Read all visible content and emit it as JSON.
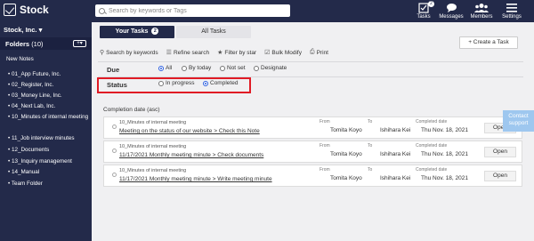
{
  "app": {
    "name": "Stock"
  },
  "search": {
    "placeholder": "Search by keywords or Tags"
  },
  "topnav": [
    {
      "label": "Tasks",
      "badge": "2"
    },
    {
      "label": "Messages"
    },
    {
      "label": "Members"
    },
    {
      "label": "Settings"
    }
  ],
  "sidebar": {
    "company": "Stock, Inc.",
    "folders_label": "Folders",
    "folders_count": "(10)",
    "new_notes": "New Notes",
    "items": [
      "01_App Future, Inc.",
      "02_Register, Inc.",
      "03_Money Line, Inc.",
      "04_Next Lab, Inc.",
      "10_Minutes of internal meeting",
      "11_Job interview minutes",
      "12_Documents",
      "13_Inquiry management",
      "14_Manual",
      "Team Folder"
    ]
  },
  "tabs": {
    "your_tasks": "Your Tasks",
    "your_tasks_count": "2",
    "all_tasks": "All Tasks"
  },
  "create_task": "+ Create a Task",
  "toolbar": {
    "search_keywords": "Search by keywords",
    "refine": "Refine search",
    "filter_star": "Filter by star",
    "bulk_modify": "Bulk Modify",
    "print": "Print"
  },
  "filters": {
    "due_label": "Due",
    "due_options": [
      "All",
      "By today",
      "Not set",
      "Designate"
    ],
    "due_selected": "All",
    "status_label": "Status",
    "status_options": [
      "In progress",
      "Completed"
    ],
    "status_selected": "Completed"
  },
  "list": {
    "sort_label": "Completion date (asc)",
    "from_label": "From",
    "to_label": "To",
    "completed_label": "Completed date",
    "open_label": "Open",
    "rows": [
      {
        "folder": "10_Minutes of internal meeting",
        "title": "Meeting on the status of our website > Check this Note",
        "from": "Tomita Koyo",
        "to": "Ishihara Kei",
        "date": "Thu Nov. 18, 2021"
      },
      {
        "folder": "10_Minutes of internal meeting",
        "title": "11/17/2021 Monthly meeting minute > Check documents",
        "from": "Tomita Koyo",
        "to": "Ishihara Kei",
        "date": "Thu Nov. 18, 2021"
      },
      {
        "folder": "10_Minutes of internal meeting",
        "title": "11/17/2021 Monthly meeting minute > Write meeting minute",
        "from": "Tomita Koyo",
        "to": "Ishihara Kei",
        "date": "Thu Nov. 18, 2021"
      }
    ]
  },
  "contact_support": "Contact support",
  "colors": {
    "navy": "#232a4a",
    "highlight": "#e01b25",
    "radio_on": "#2c5fe0",
    "contact": "#9ec7ef"
  }
}
